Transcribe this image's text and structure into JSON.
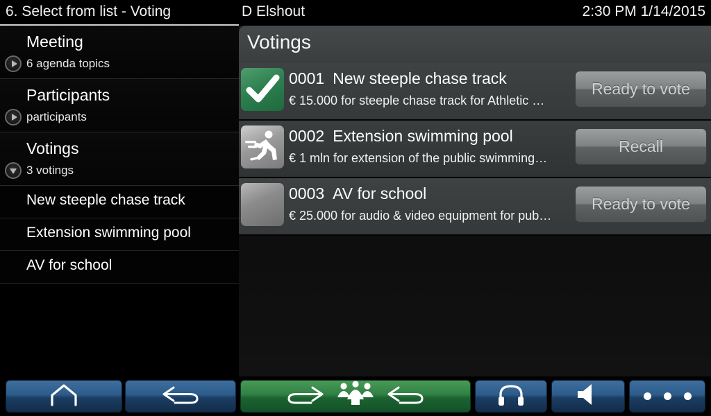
{
  "titlebar": {
    "title": "6. Select from list - Voting",
    "user": "D Elshout",
    "clock": "2:30 PM 1/14/2015"
  },
  "sidebar": {
    "groups": [
      {
        "title": "Meeting",
        "subtitle": "6 agenda topics",
        "state": "collapsed",
        "icon": "chevron-right-icon"
      },
      {
        "title": "Participants",
        "subtitle": "participants",
        "state": "collapsed",
        "icon": "chevron-right-icon"
      },
      {
        "title": "Votings",
        "subtitle": "3 votings",
        "state": "expanded",
        "icon": "chevron-down-icon"
      }
    ],
    "children": [
      {
        "label": "New steeple chase track"
      },
      {
        "label": "Extension swimming pool"
      },
      {
        "label": "AV for school"
      }
    ]
  },
  "main": {
    "header_title": "Votings",
    "rows": [
      {
        "number": "0001",
        "title": "New steeple chase track",
        "description": "€ 15.000 for steeple chase track for Athletic …",
        "status_icon": "checkmark-icon",
        "status_color": "#2f8050",
        "button_label": "Ready to vote"
      },
      {
        "number": "0002",
        "title": "Extension swimming pool",
        "description": "€ 1 mln for extension of the public swimming…",
        "status_icon": "running-person-icon",
        "status_color": "#8c8c8c",
        "button_label": "Recall"
      },
      {
        "number": "0003",
        "title": "AV for school",
        "description": "€ 25.000 for audio & video equipment for pub…",
        "status_icon": "blank-icon",
        "status_color": "#9a9a9a",
        "button_label": "Ready to vote"
      }
    ]
  },
  "toolbar": {
    "buttons": [
      {
        "name": "home-button",
        "icon": "home-icon",
        "color": "#2d5b8a"
      },
      {
        "name": "back-button",
        "icon": "back-arrow-icon",
        "color": "#2d5b8a"
      },
      {
        "name": "request-to-speak-button",
        "icon": "forward-arrow-group-back-arrow-icon",
        "color": "#2f8043"
      },
      {
        "name": "headset-button",
        "icon": "headphones-icon",
        "color": "#2d5b8a"
      },
      {
        "name": "volume-button",
        "icon": "speaker-icon",
        "color": "#2d5b8a"
      },
      {
        "name": "more-button",
        "icon": "ellipsis-icon",
        "color": "#2d5b8a"
      }
    ]
  }
}
